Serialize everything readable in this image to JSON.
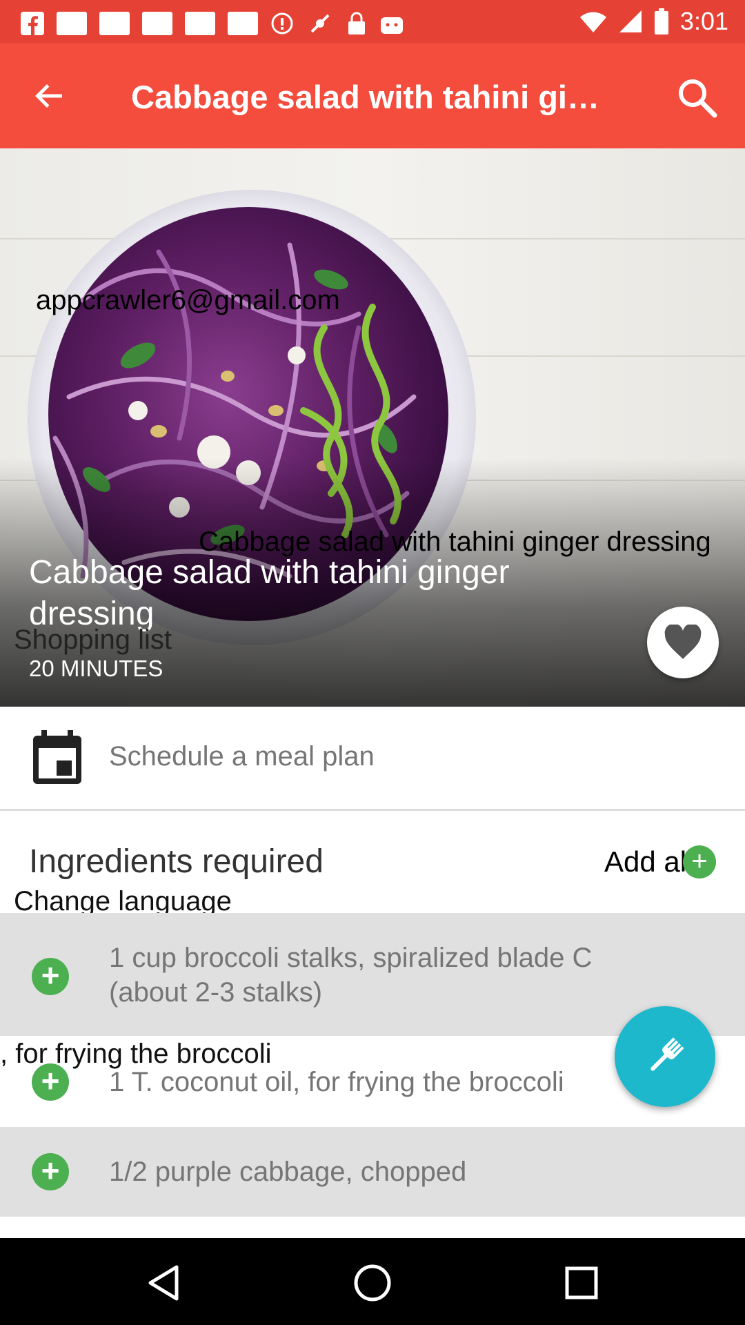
{
  "status_bar": {
    "time": "3:01",
    "icons": [
      "facebook-icon",
      "image-icon",
      "image-icon",
      "image-icon",
      "image-icon",
      "image-icon",
      "alert-icon",
      "signal-off-icon",
      "lock-icon",
      "android-icon",
      "wifi-icon",
      "cellular-icon",
      "battery-icon"
    ]
  },
  "app_bar": {
    "title": "Cabbage salad with tahini gi…",
    "color": "#f44c3d"
  },
  "hero": {
    "overlay_email": "appcrawler6@gmail.com",
    "overlay_title": "Cabbage salad with tahini ginger dressing",
    "recipe_title": "Cabbage salad with tahini ginger dressing",
    "time": "20 MINUTES",
    "shopping_list_label": "Shopping list"
  },
  "schedule": {
    "label": "Schedule a meal plan"
  },
  "ingredients": {
    "header": "Ingredients required",
    "add_all_label": "Add all",
    "change_language_label": "Change language",
    "items": [
      {
        "text": "1 cup broccoli stalks, spiralized blade C (about 2-3 stalks)"
      },
      {
        "text": "1 T. coconut oil, for frying the broccoli"
      },
      {
        "text": "1/2 purple cabbage, chopped"
      }
    ],
    "overlay_text": ", for frying the broccoli"
  },
  "colors": {
    "accent": "#4caf50",
    "fab": "#1eb8cc",
    "status_bar": "#e54235"
  }
}
